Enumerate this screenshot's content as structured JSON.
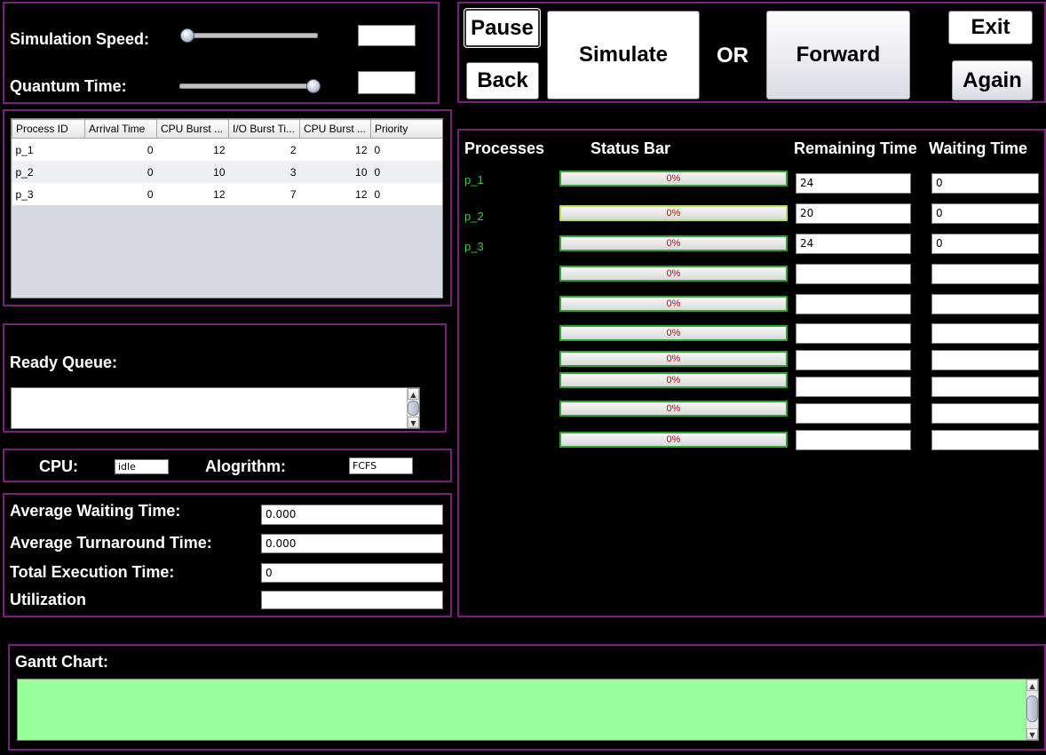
{
  "controls": {
    "speed_label": "Simulation Speed:",
    "speed_value": "",
    "speed_level": 0.0,
    "quantum_label": "Quantum Time:",
    "quantum_value": "",
    "quantum_level": 1.0
  },
  "buttons": {
    "pause": "Pause",
    "back": "Back",
    "simulate": "Simulate",
    "or": "OR",
    "forward": "Forward",
    "exit": "Exit",
    "again": "Again"
  },
  "table": {
    "headers": [
      "Process ID",
      "Arrival Time",
      "CPU Burst ...",
      "I/O Burst Ti...",
      "CPU Burst ...",
      "Priority"
    ],
    "rows": [
      [
        "p_1",
        "0",
        "12",
        "2",
        "12",
        "0"
      ],
      [
        "p_2",
        "0",
        "10",
        "3",
        "10",
        "0"
      ],
      [
        "p_3",
        "0",
        "12",
        "7",
        "12",
        "0"
      ]
    ]
  },
  "ready_queue": {
    "label": "Ready Queue:",
    "value": ""
  },
  "cpu": {
    "label": "CPU:",
    "value": "idle",
    "algorithm_label": "Alogrithm:",
    "algorithm_value": "FCFS"
  },
  "stats": {
    "avg_waiting_label": "Average Waiting Time:",
    "avg_waiting": "0.000",
    "avg_turnaround_label": "Average Turnaround Time:",
    "avg_turnaround": "0.000",
    "total_exec_label": "Total Execution Time:",
    "total_exec": "0",
    "utilization_label": "Utilization",
    "utilization": ""
  },
  "status": {
    "headers": {
      "processes": "Processes",
      "status_bar": "Status Bar",
      "remaining": "Remaining Time",
      "waiting": "Waiting Time"
    },
    "rows": [
      {
        "name": "p_1",
        "progress": "0%",
        "remaining": "24",
        "waiting": "0"
      },
      {
        "name": "p_2",
        "progress": "0%",
        "remaining": "20",
        "waiting": "0"
      },
      {
        "name": "p_3",
        "progress": "0%",
        "remaining": "24",
        "waiting": "0"
      },
      {
        "name": "",
        "progress": "0%",
        "remaining": "",
        "waiting": ""
      },
      {
        "name": "",
        "progress": "0%",
        "remaining": "",
        "waiting": ""
      },
      {
        "name": "",
        "progress": "0%",
        "remaining": "",
        "waiting": ""
      },
      {
        "name": "",
        "progress": "0%",
        "remaining": "",
        "waiting": ""
      },
      {
        "name": "",
        "progress": "0%",
        "remaining": "",
        "waiting": ""
      },
      {
        "name": "",
        "progress": "0%",
        "remaining": "",
        "waiting": ""
      },
      {
        "name": "",
        "progress": "0%",
        "remaining": "",
        "waiting": ""
      }
    ]
  },
  "gantt": {
    "label": "Gantt Chart:",
    "value": ""
  },
  "colors": {
    "panel_border": "#7a1f7a",
    "process_name": "#3ccf3c",
    "progress_text": "#e00000",
    "gantt_bg": "#99ff99"
  }
}
